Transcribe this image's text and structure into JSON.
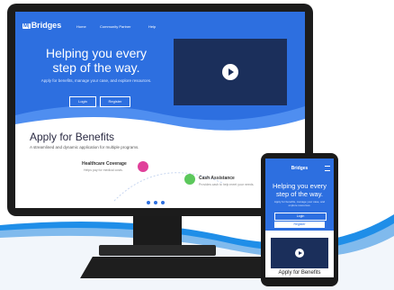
{
  "colors": {
    "brand_blue": "#2d6fe0",
    "dark_video": "#1b2f5b",
    "accent_pink": "#e0409a",
    "accent_green": "#5cc85c",
    "swoosh": "#1f8ee8"
  },
  "desktop": {
    "logo": "Bridges",
    "logo_mark": "M|",
    "nav": [
      "Home",
      "Community Partner",
      "Help"
    ],
    "hero_title": "Helping you every step of the way.",
    "hero_subtitle": "Apply for benefits, manage your case, and explore resources.",
    "login_label": "Login",
    "register_label": "Register",
    "apply_title": "Apply for Benefits",
    "apply_subtitle": "A streamlined and dynamic application for multiple programs.",
    "programs": [
      {
        "title": "Healthcare Coverage",
        "subtitle": "Helps pay for medical costs.",
        "icon": "medical-icon"
      },
      {
        "title": "Cash Assistance",
        "subtitle": "Provides cash to help meet your needs.",
        "icon": "cash-icon"
      }
    ]
  },
  "phone": {
    "logo": "Bridges",
    "hero_title": "Helping you every step of the way.",
    "hero_subtitle": "Apply for benefits, manage your case, and explore resources.",
    "login_label": "Login",
    "register_label": "Register",
    "apply_title": "Apply for Benefits"
  }
}
